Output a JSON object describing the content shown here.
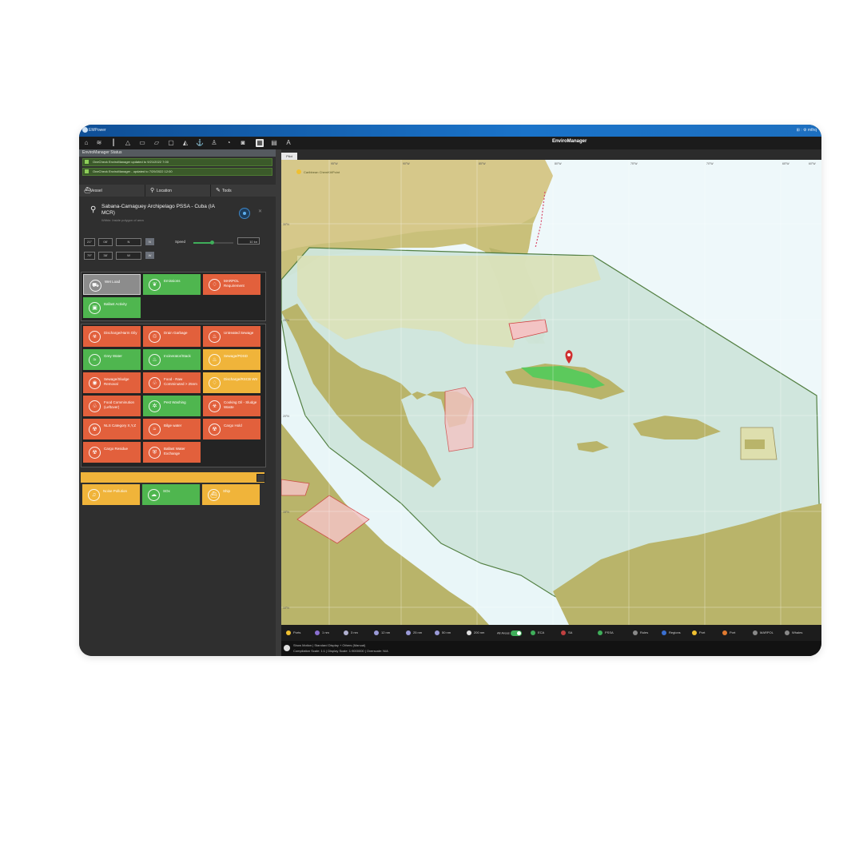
{
  "window": {
    "app_name": "EMPower",
    "title": "EnviroManager",
    "right_text": "⊞ :   ⚙ mthq"
  },
  "toolbar": {
    "icons": [
      "home-icon",
      "layers-icon",
      "ruler-icon",
      "warning-icon",
      "document-icon",
      "book-icon",
      "map-icon",
      "ship-icon",
      "anchor-icon",
      "person-icon",
      "clock-icon",
      "camera-icon",
      "grid-icon",
      "table-icon",
      "text-icon"
    ]
  },
  "sidebar": {
    "header": "EnviroManager Status",
    "notices": [
      "OneCheck EnviroManager updated to 9/21/2022 7:00",
      "OneCheck EnviroManager - updated to 7/29/2022 12:00"
    ],
    "tabs": [
      {
        "label": "Vessel",
        "icon": "ship-icon"
      },
      {
        "label": "Location",
        "icon": "pin-icon"
      },
      {
        "label": "Tools",
        "icon": "wrench-icon"
      }
    ],
    "site": {
      "name": "Sabana-Camaguey Archipelago PSSA - Cuba (IA MCR)",
      "sub": "Within: Inside polygon of area"
    },
    "coords": {
      "row1": [
        "21°",
        "08'",
        "N",
        "N"
      ],
      "row2": [
        "79°",
        "38'",
        "W",
        "W"
      ],
      "speed_label": "Speed",
      "speed_value": "10 kn",
      "speed_level": 0.45
    },
    "group1": [
      {
        "label": "Wet Load",
        "color": "gray",
        "icon": "truck-icon"
      },
      {
        "label": "Emissions",
        "color": "green",
        "icon": "leaf-icon"
      },
      {
        "label": "MARPOL Requirement",
        "color": "red",
        "icon": "drop-icon"
      },
      {
        "label": "Ballast Activity",
        "color": "green",
        "icon": "tank-icon"
      }
    ],
    "group2": [
      {
        "label": "Discharge/Harm Oily",
        "color": "red",
        "icon": "oil-icon"
      },
      {
        "label": "Drain Garbage",
        "color": "red",
        "icon": "bin-icon"
      },
      {
        "label": "Untreated Sewage",
        "color": "red",
        "icon": "sewage-icon"
      },
      {
        "label": "Grey Water",
        "color": "green",
        "icon": "water-icon"
      },
      {
        "label": "Incinerator/Stack",
        "color": "green",
        "icon": "fire-icon"
      },
      {
        "label": "Sewage/PDSD",
        "color": "amber",
        "icon": "sewage-icon"
      },
      {
        "label": "Sewage/Sludge Removal",
        "color": "red",
        "icon": "sludge-icon"
      },
      {
        "label": "Food - Raw Comminuted > 25nm",
        "color": "red",
        "icon": "food-icon"
      },
      {
        "label": "Discharge/RSCB Wtr",
        "color": "amber",
        "icon": "discharge-icon"
      },
      {
        "label": "Food Comminution (Leftover)",
        "color": "red",
        "icon": "food-icon"
      },
      {
        "label": "Pest Washing",
        "color": "green",
        "icon": "spray-icon"
      },
      {
        "label": "Cooking Oil - Sludge Waste",
        "color": "red",
        "icon": "oil-icon"
      },
      {
        "label": "NLS Category X,Y,Z",
        "color": "red",
        "icon": "hazard-icon"
      },
      {
        "label": "Bilge water",
        "color": "red",
        "icon": "bilge-icon"
      },
      {
        "label": "Cargo Hold",
        "color": "red",
        "icon": "hazard-icon"
      },
      {
        "label": "Cargo Residue",
        "color": "red",
        "icon": "hazard-icon"
      },
      {
        "label": "Ballast Water Exchange",
        "color": "red",
        "icon": "shield-icon"
      }
    ],
    "group3": [
      {
        "label": "Noise Pollution",
        "color": "amber",
        "icon": "noise-icon"
      },
      {
        "label": "SOx",
        "color": "green",
        "icon": "sox-icon"
      },
      {
        "label": "Ship",
        "color": "amber",
        "icon": "ship-icon"
      }
    ]
  },
  "map": {
    "tab": "Pilot",
    "legend_top": "Caribbean ChemKit/Point",
    "lat_labels": [
      "30°N",
      "25°N",
      "20°N",
      "15°N",
      "10°N"
    ],
    "lon_labels": [
      "95°W",
      "90°W",
      "85°W",
      "80°W",
      "75°W",
      "70°W",
      "65°W",
      "60°W"
    ]
  },
  "legend": {
    "items": [
      {
        "label": "Ports",
        "color": "#f0c030"
      },
      {
        "label": "1 nm",
        "color": "#8a6fd0"
      },
      {
        "label": "3 nm",
        "color": "#b0b0d0"
      },
      {
        "label": "12 nm",
        "color": "#9a9ad8"
      },
      {
        "label": "25 nm",
        "color": "#9a9ad8"
      },
      {
        "label": "50 nm",
        "color": "#9a9ad8"
      },
      {
        "label": "200 nm",
        "color": "#e0e0e0"
      },
      {
        "label": "All Areas",
        "color": ""
      },
      {
        "label": "ECA",
        "color": "#3fae5a"
      },
      {
        "label": "SA",
        "color": "#c04040"
      },
      {
        "label": "PSSA",
        "color": "#3fae5a"
      },
      {
        "label": "Rules",
        "color": "#888888"
      },
      {
        "label": "Regions",
        "color": "#3a6fd0"
      },
      {
        "label": "Port",
        "color": "#f0c030"
      },
      {
        "label": "Port",
        "color": "#e07a30"
      },
      {
        "label": "MARPOL",
        "color": "#888888"
      },
      {
        "label": "Whales",
        "color": "#888888"
      }
    ]
  },
  "status": {
    "line1": "Show Motion | Standard Display + Others (Manual)",
    "line2": "Compilation Scale: 1:1 | Display Scale: 1:9000000 | Overscale: N/A"
  }
}
